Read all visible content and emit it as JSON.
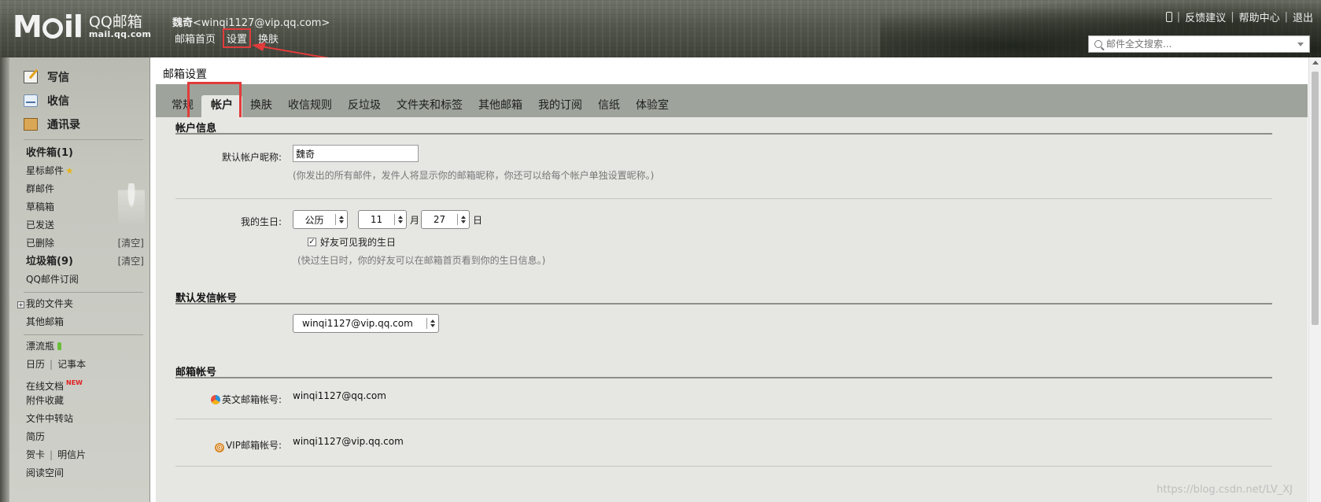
{
  "header": {
    "logo_text": "M",
    "logo_text2": "il",
    "brand_cn": "QQ邮箱",
    "brand_domain": "mail.qq.com",
    "user_nick": "魏奇",
    "user_email": "<winqi1127@vip.qq.com>",
    "nav": [
      "邮箱首页",
      "设置",
      "换肤"
    ],
    "links": [
      "反馈建议",
      "帮助中心",
      "退出"
    ],
    "search_placeholder": "邮件全文搜索..."
  },
  "sidebar": {
    "actions": [
      "写信",
      "收信",
      "通讯录"
    ],
    "folders": [
      {
        "label": "收件箱(1)"
      },
      {
        "label": "星标邮件"
      },
      {
        "label": "群邮件"
      },
      {
        "label": "草稿箱"
      },
      {
        "label": "已发送"
      },
      {
        "label": "已删除",
        "action": "[清空]"
      },
      {
        "label": "垃圾箱(9)",
        "action": "[清空]"
      },
      {
        "label": "QQ邮件订阅"
      }
    ],
    "my_folders": "我的文件夹",
    "other_mailbox": "其他邮箱",
    "tools": {
      "drift_bottle": "漂流瓶",
      "calendar": "日历",
      "notepad": "记事本",
      "online_docs": "在线文档",
      "new_badge": "NEW",
      "attachments": "附件收藏",
      "file_transfer": "文件中转站",
      "resume": "简历",
      "greeting_card": "贺卡",
      "postcard": "明信片",
      "reading_space": "阅读空间"
    }
  },
  "main": {
    "title": "邮箱设置",
    "tabs": [
      "常规",
      "帐户",
      "换肤",
      "收信规则",
      "反垃圾",
      "文件夹和标签",
      "其他邮箱",
      "我的订阅",
      "信纸",
      "体验室"
    ],
    "active_tab": "帐户",
    "account_info": {
      "section": "帐户信息",
      "nickname_label": "默认帐户昵称:",
      "nickname_value": "魏奇",
      "nickname_hint": "(你发出的所有邮件，发件人将显示你的邮箱昵称，你还可以给每个帐户单独设置昵称。)",
      "birthday_label": "我的生日:",
      "calendar_type": "公历",
      "month": "11",
      "month_unit": "月",
      "day": "27",
      "day_unit": "日",
      "friends_visible": "好友可见我的生日",
      "birthday_hint": "(快过生日时，你的好友可以在邮箱首页看到你的生日信息。)"
    },
    "default_sender": {
      "section": "默认发信帐号",
      "value": "winqi1127@vip.qq.com"
    },
    "mail_accounts": {
      "section": "邮箱帐号",
      "english_label": "英文邮箱帐号:",
      "english_value": "winqi1127@qq.com",
      "vip_label": "VIP邮箱帐号:",
      "vip_value": "winqi1127@vip.qq.com"
    }
  },
  "watermark": "https://blog.csdn.net/LV_XJ",
  "colors": {
    "annotation_red": "#e23b3b",
    "tab_bar": "#9ea39b",
    "panel_bg": "#e6e7e3"
  }
}
